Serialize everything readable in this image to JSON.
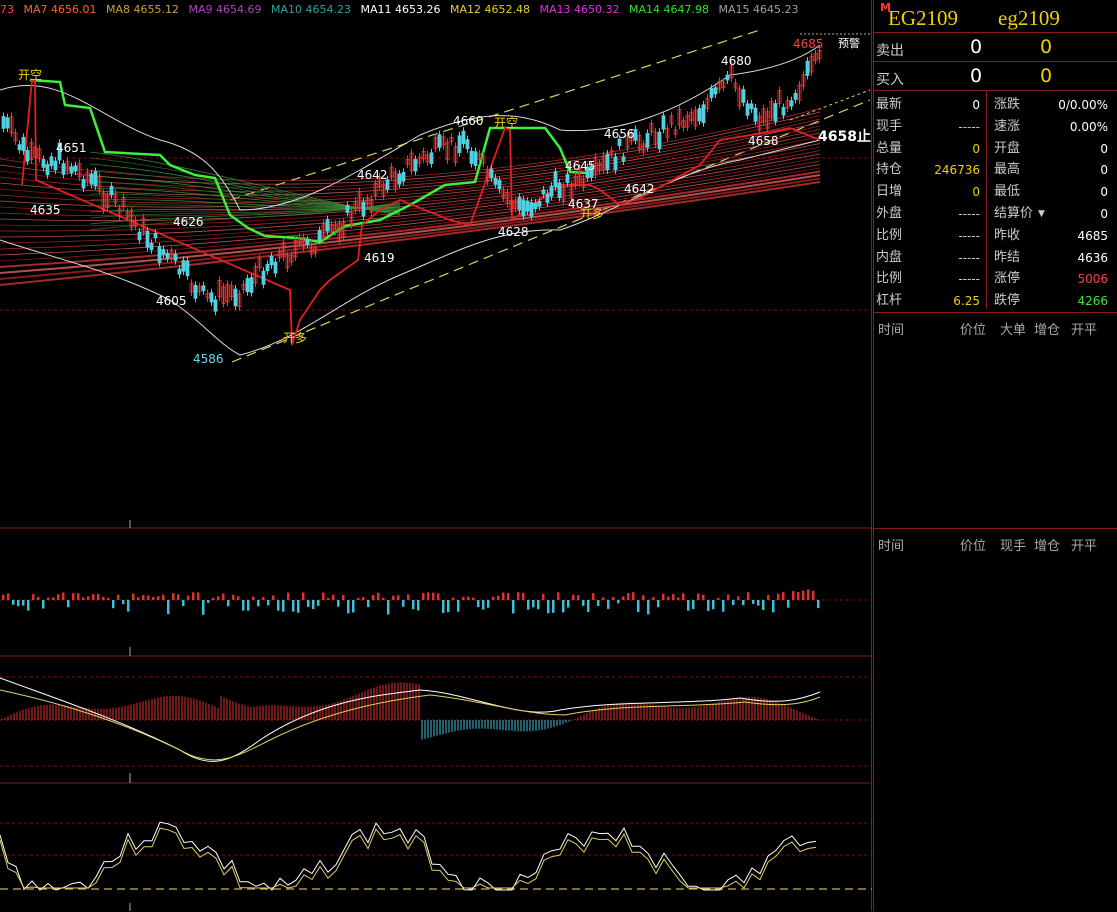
{
  "ma_bar": [
    {
      "label": "73",
      "color": "#ff4040"
    },
    {
      "label": "MA7 4656.01",
      "color": "#ff6030"
    },
    {
      "label": "MA8 4655.12",
      "color": "#c8a040"
    },
    {
      "label": "MA9 4654.69",
      "color": "#b040c0"
    },
    {
      "label": "MA10 4654.23",
      "color": "#30a0a0"
    },
    {
      "label": "MA11 4653.26",
      "color": "#ffffff"
    },
    {
      "label": "MA12 4652.48",
      "color": "#e0d030"
    },
    {
      "label": "MA13 4650.32",
      "color": "#e030e0"
    },
    {
      "label": "MA14 4647.98",
      "color": "#30e030"
    },
    {
      "label": "MA15 4645.23",
      "color": "#a0a0a0"
    }
  ],
  "chart_labels": {
    "high_right": "4685",
    "alarm": "预警",
    "stop_line": "4658止",
    "open_short_1": "开空",
    "open_short_2": "开空",
    "open_long_1": "开多",
    "open_long_2": "开多",
    "prices": [
      "4651",
      "4635",
      "4626",
      "4605",
      "4586",
      "4642",
      "4619",
      "4660",
      "4628",
      "4645",
      "4637",
      "4656",
      "4642",
      "4680",
      "4658"
    ]
  },
  "panel": {
    "marker": "M",
    "code_upper": "EG2109",
    "code_lower": "eg2109",
    "sell_label": "卖出",
    "sell_price": "0",
    "sell_vol": "0",
    "buy_label": "买入",
    "buy_price": "0",
    "buy_vol": "0",
    "left": [
      {
        "label": "最新",
        "value": "0",
        "color": "#ffffff"
      },
      {
        "label": "现手",
        "value": "-----",
        "color": "#f0d000"
      },
      {
        "label": "总量",
        "value": "0",
        "color": "#f0d000"
      },
      {
        "label": "持仓",
        "value": "246736",
        "color": "#f0d000"
      },
      {
        "label": "日增",
        "value": "0",
        "color": "#f0d000"
      },
      {
        "label": "外盘",
        "value": "-----",
        "color": "#ccc"
      },
      {
        "label": "比例",
        "value": "-----",
        "color": "#ccc"
      },
      {
        "label": "内盘",
        "value": "-----",
        "color": "#ccc"
      },
      {
        "label": "比例",
        "value": "-----",
        "color": "#ccc"
      },
      {
        "label": "杠杆",
        "value": "6.25",
        "color": "#f0d000"
      }
    ],
    "right": [
      {
        "label": "涨跌",
        "value": "0/0.00%",
        "color": "#ffffff"
      },
      {
        "label": "速涨",
        "value": "0.00%",
        "color": "#ffffff"
      },
      {
        "label": "开盘",
        "value": "0",
        "color": "#ffffff"
      },
      {
        "label": "最高",
        "value": "0",
        "color": "#ffffff"
      },
      {
        "label": "最低",
        "value": "0",
        "color": "#ffffff"
      },
      {
        "label": "结算价",
        "value": "0",
        "color": "#ffffff"
      },
      {
        "label": "昨收",
        "value": "4685",
        "color": "#ffffff"
      },
      {
        "label": "昨结",
        "value": "4636",
        "color": "#ffffff"
      },
      {
        "label": "涨停",
        "value": "5006",
        "color": "#ff4040"
      },
      {
        "label": "跌停",
        "value": "4266",
        "color": "#40e040"
      }
    ],
    "trades_header": [
      "时间",
      "价位",
      "大单",
      "增仓",
      "开平"
    ],
    "ticks_header": [
      "时间",
      "价位",
      "现手",
      "增仓",
      "开平"
    ]
  }
}
